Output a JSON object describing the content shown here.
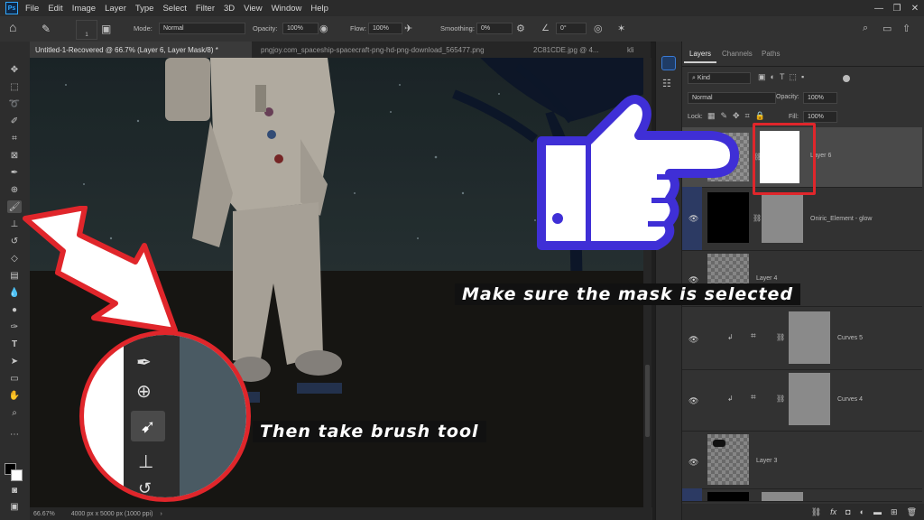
{
  "menubar": {
    "logo": "Ps",
    "items": [
      "File",
      "Edit",
      "Image",
      "Layer",
      "Type",
      "Select",
      "Filter",
      "3D",
      "View",
      "Window",
      "Help"
    ]
  },
  "options": {
    "brush_size": "1",
    "mode_label": "Mode:",
    "mode_value": "Normal",
    "opacity_label": "Opacity:",
    "opacity_value": "100%",
    "flow_label": "Flow:",
    "flow_value": "100%",
    "smoothing_label": "Smoothing:",
    "smoothing_value": "0%",
    "angle_value": "0°"
  },
  "tabs": [
    {
      "label": "Untitled-1-Recovered @ 66.7% (Layer 6, Layer Mask/8) *"
    },
    {
      "label": "pngjoy.com_spaceship-spacecraft-png-hd-png-download_565477.png"
    },
    {
      "label": "2C81CDE.jpg @ 4..."
    },
    {
      "label": "kli"
    }
  ],
  "status": {
    "zoom": "66.67%",
    "doc_info": "4000 px x 5000 px (1000 ppi)"
  },
  "layers_panel": {
    "tabs": [
      "Layers",
      "Channels",
      "Paths"
    ],
    "kind_label": "Kind",
    "blend_mode": "Normal",
    "opacity_label": "Opacity:",
    "opacity_value": "100%",
    "lock_label": "Lock:",
    "fill_label": "Fill:",
    "fill_value": "100%",
    "layers": [
      {
        "name": "Layer 6"
      },
      {
        "name": "Oniric_Element - glow"
      },
      {
        "name": "Layer 4"
      },
      {
        "name": "Curves 5"
      },
      {
        "name": "Curves 4"
      },
      {
        "name": "Layer 3"
      }
    ],
    "footer_icons": [
      "link-icon",
      "fx-icon",
      "mask-icon",
      "adjustment-icon",
      "folder-icon",
      "new-layer-icon",
      "trash-icon"
    ]
  },
  "overlays": {
    "caption_mask": "Make sure the mask is selected",
    "caption_brush": "Then take brush tool"
  },
  "colors": {
    "highlight_red": "#e0262b",
    "hand_blue": "#3f2fd6",
    "caption_bg": "#111111"
  }
}
